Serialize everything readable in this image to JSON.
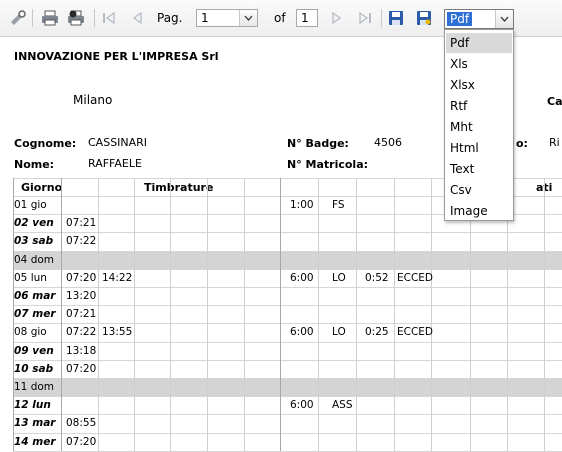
{
  "toolbar": {
    "icons": [
      "settings-icon",
      "print-icon",
      "print-setup-icon",
      "first-page-icon",
      "prev-page-icon",
      "next-page-icon",
      "last-page-icon",
      "save-icon",
      "save-as-icon"
    ],
    "page_label": "Pag.",
    "current_page": "1",
    "of_label": "of",
    "total_pages": "1",
    "export_format": "Pdf",
    "export_options": [
      "Pdf",
      "Xls",
      "Xlsx",
      "Rtf",
      "Mht",
      "Html",
      "Text",
      "Csv",
      "Image"
    ]
  },
  "report": {
    "company": "INNOVAZIONE PER L'IMPRESA Srl",
    "city": "Milano",
    "right_label": "Ca",
    "surname_label": "Cognome:",
    "surname": "CASSINARI",
    "name_label": "Nome:",
    "name": "RAFFAELE",
    "badge_label": "N° Badge:",
    "badge": "4506",
    "matricola_label": "N° Matricola:",
    "right_field_label": "o:",
    "right_field_value": "Ri",
    "col_day": "Giorno",
    "col_punches": "Timbrature",
    "col_right": "ati"
  },
  "rows": [
    {
      "day": "01 gio",
      "holiday": false,
      "t1": "",
      "t2": "",
      "h": "1:00",
      "code": "FS",
      "ex": "",
      "exc": ""
    },
    {
      "day": "02 ven",
      "holiday": false,
      "t1": "07:21",
      "t2": "",
      "h": "",
      "code": "",
      "ex": "",
      "exc": ""
    },
    {
      "day": "03 sab",
      "holiday": false,
      "t1": "07:22",
      "t2": "",
      "h": "",
      "code": "",
      "ex": "",
      "exc": ""
    },
    {
      "day": "04 dom",
      "holiday": true,
      "t1": "",
      "t2": "",
      "h": "",
      "code": "",
      "ex": "",
      "exc": ""
    },
    {
      "day": "05 lun",
      "holiday": false,
      "t1": "07:20",
      "t2": "14:22",
      "h": "6:00",
      "code": "LO",
      "ex": "0:52",
      "exc": "ECCED"
    },
    {
      "day": "06 mar",
      "holiday": false,
      "t1": "13:20",
      "t2": "",
      "h": "",
      "code": "",
      "ex": "",
      "exc": ""
    },
    {
      "day": "07 mer",
      "holiday": false,
      "t1": "07:21",
      "t2": "",
      "h": "",
      "code": "",
      "ex": "",
      "exc": ""
    },
    {
      "day": "08 gio",
      "holiday": false,
      "t1": "07:22",
      "t2": "13:55",
      "h": "6:00",
      "code": "LO",
      "ex": "0:25",
      "exc": "ECCED"
    },
    {
      "day": "09 ven",
      "holiday": false,
      "t1": "13:18",
      "t2": "",
      "h": "",
      "code": "",
      "ex": "",
      "exc": ""
    },
    {
      "day": "10 sab",
      "holiday": false,
      "t1": "07:20",
      "t2": "",
      "h": "",
      "code": "",
      "ex": "",
      "exc": ""
    },
    {
      "day": "11 dom",
      "holiday": true,
      "t1": "",
      "t2": "",
      "h": "",
      "code": "",
      "ex": "",
      "exc": ""
    },
    {
      "day": "12 lun",
      "holiday": false,
      "t1": "",
      "t2": "",
      "h": "6:00",
      "code": "ASS",
      "ex": "",
      "exc": ""
    },
    {
      "day": "13 mar",
      "holiday": false,
      "t1": "08:55",
      "t2": "",
      "h": "",
      "code": "",
      "ex": "",
      "exc": ""
    },
    {
      "day": "14 mer",
      "holiday": false,
      "t1": "07:20",
      "t2": "",
      "h": "",
      "code": "",
      "ex": "",
      "exc": ""
    }
  ]
}
